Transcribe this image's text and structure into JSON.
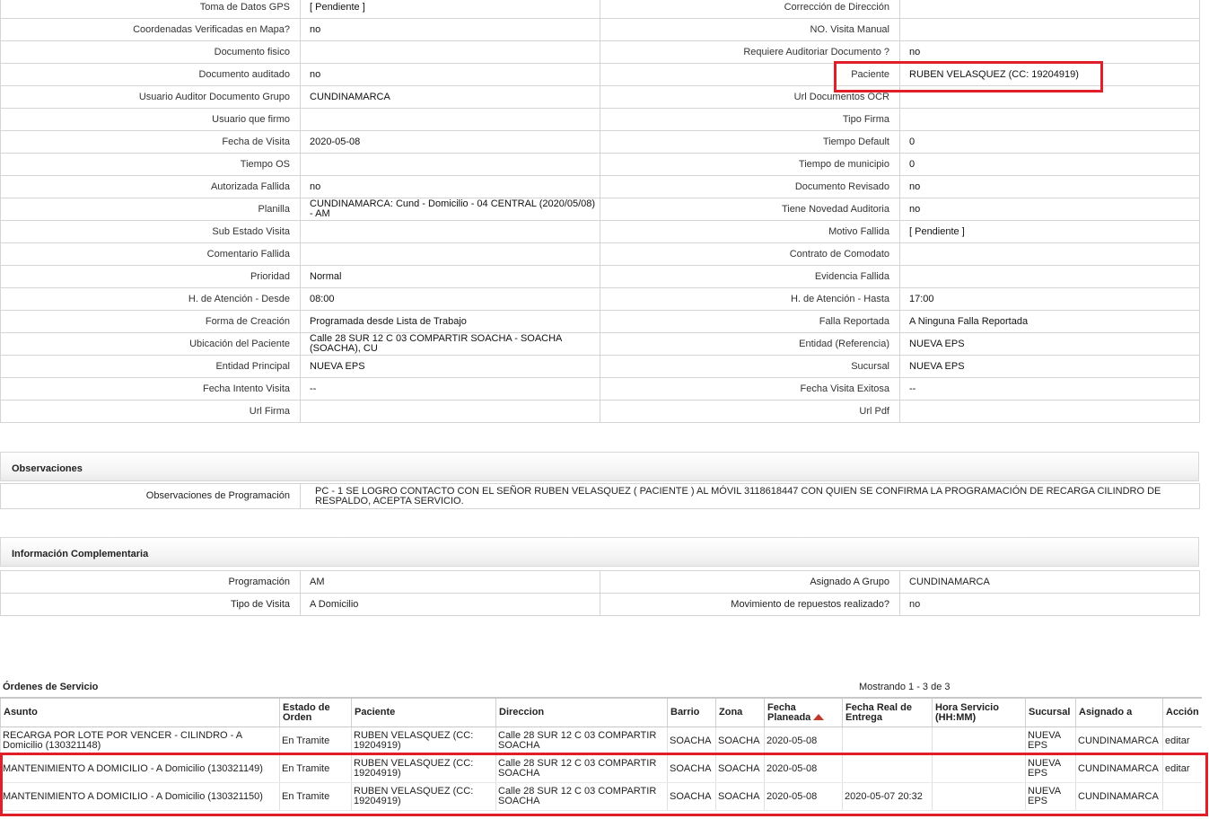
{
  "detail_rows": [
    {
      "l1": "Toma de Datos GPS",
      "v1": "[ Pendiente ]",
      "l2": "Corrección de Dirección",
      "v2": ""
    },
    {
      "l1": "Coordenadas Verificadas en Mapa?",
      "v1": "no",
      "l2": "NO. Visita Manual",
      "v2": ""
    },
    {
      "l1": "Documento fisico",
      "v1": "",
      "l2": "Requiere Auditoriar Documento ?",
      "v2": "no"
    },
    {
      "l1": "Documento auditado",
      "v1": "no",
      "l2": "Paciente",
      "v2": "RUBEN VELASQUEZ (CC: 19204919)"
    },
    {
      "l1": "Usuario Auditor Documento Grupo",
      "v1": "CUNDINAMARCA",
      "l2": "Url Documentos OCR",
      "v2": ""
    },
    {
      "l1": "Usuario que firmo",
      "v1": "",
      "l2": "Tipo Firma",
      "v2": ""
    },
    {
      "l1": "Fecha de Visita",
      "v1": "2020-05-08",
      "l2": "Tiempo Default",
      "v2": "0"
    },
    {
      "l1": "Tiempo OS",
      "v1": "",
      "l2": "Tiempo de municipio",
      "v2": "0"
    },
    {
      "l1": "Autorizada Fallida",
      "v1": "no",
      "l2": "Documento Revisado",
      "v2": "no"
    },
    {
      "l1": "Planilla",
      "v1": "CUNDINAMARCA: Cund - Domicilio - 04 CENTRAL (2020/05/08) - AM",
      "l2": "Tiene Novedad Auditoria",
      "v2": "no"
    },
    {
      "l1": "Sub Estado Visita",
      "v1": "",
      "l2": "Motivo Fallida",
      "v2": "[ Pendiente ]"
    },
    {
      "l1": "Comentario Fallida",
      "v1": "",
      "l2": "Contrato de Comodato",
      "v2": ""
    },
    {
      "l1": "Prioridad",
      "v1": "Normal",
      "l2": "Evidencia Fallida",
      "v2": ""
    },
    {
      "l1": "H. de Atención - Desde",
      "v1": "08:00",
      "l2": "H. de Atención - Hasta",
      "v2": "17:00"
    },
    {
      "l1": "Forma de Creación",
      "v1": "Programada desde Lista de Trabajo",
      "l2": "Falla Reportada",
      "v2": "A Ninguna Falla Reportada"
    },
    {
      "l1": "Ubicación del Paciente",
      "v1": "Calle 28 SUR 12 C 03 COMPARTIR SOACHA - SOACHA (SOACHA), CU",
      "l2": "Entidad (Referencia)",
      "v2": "NUEVA EPS"
    },
    {
      "l1": "Entidad Principal",
      "v1": "NUEVA EPS",
      "l2": "Sucursal",
      "v2": "NUEVA EPS"
    },
    {
      "l1": "Fecha Intento Visita",
      "v1": "--",
      "l2": "Fecha Visita Exitosa",
      "v2": "--"
    },
    {
      "l1": "Url Firma",
      "v1": "",
      "l2": "Url Pdf",
      "v2": ""
    }
  ],
  "observaciones": {
    "title": "Observaciones",
    "label": "Observaciones de Programación",
    "value": "PC - 1 SE LOGRO CONTACTO CON EL SEÑOR RUBEN VELASQUEZ ( PACIENTE ) AL MÓVIL 3118618447 CON QUIEN SE CONFIRMA LA PROGRAMACIÓN DE RECARGA CILINDRO DE RESPALDO, ACEPTA SERVICIO."
  },
  "complementaria": {
    "title": "Información Complementaria",
    "rows": [
      {
        "l1": "Programación",
        "v1": "AM",
        "l2": "Asignado A Grupo",
        "v2": "CUNDINAMARCA"
      },
      {
        "l1": "Tipo de Visita",
        "v1": "A Domicilio",
        "l2": "Movimiento de repuestos realizado?",
        "v2": "no"
      }
    ]
  },
  "ordenes": {
    "title": "Órdenes de Servicio",
    "count": "Mostrando 1 - 3 de 3",
    "headers": [
      "Asunto",
      "Estado de Orden",
      "Paciente",
      "Direccion",
      "Barrio",
      "Zona",
      "Fecha Planeada",
      "Fecha Real de Entrega",
      "Hora Servicio (HH:MM)",
      "Sucursal",
      "Asignado a",
      "Acción"
    ],
    "rows": [
      {
        "asunto": "RECARGA POR LOTE POR VENCER - CILINDRO - A Domicilio (130321148)",
        "estado": "En Tramite",
        "paciente": "RUBEN VELASQUEZ (CC: 19204919)",
        "direccion": "Calle 28 SUR 12 C 03 COMPARTIR SOACHA",
        "barrio": "SOACHA",
        "zona": "SOACHA",
        "fecha_planeada": "2020-05-08",
        "fecha_real": "",
        "hora": "",
        "sucursal": "NUEVA EPS",
        "asignado": "CUNDINAMARCA",
        "accion": "editar"
      },
      {
        "asunto": "MANTENIMIENTO A DOMICILIO - A Domicilio (130321149)",
        "estado": "En Tramite",
        "paciente": "RUBEN VELASQUEZ (CC: 19204919)",
        "direccion": "Calle 28 SUR 12 C 03 COMPARTIR SOACHA",
        "barrio": "SOACHA",
        "zona": "SOACHA",
        "fecha_planeada": "2020-05-08",
        "fecha_real": "",
        "hora": "",
        "sucursal": "NUEVA EPS",
        "asignado": "CUNDINAMARCA",
        "accion": "editar"
      },
      {
        "asunto": "MANTENIMIENTO A DOMICILIO - A Domicilio (130321150)",
        "estado": "En Tramite",
        "paciente": "RUBEN VELASQUEZ (CC: 19204919)",
        "direccion": "Calle 28 SUR 12 C 03 COMPARTIR SOACHA",
        "barrio": "SOACHA",
        "zona": "SOACHA",
        "fecha_planeada": "2020-05-08",
        "fecha_real": "2020-05-07 20:32",
        "hora": "",
        "sucursal": "NUEVA EPS",
        "asignado": "CUNDINAMARCA",
        "accion": ""
      }
    ]
  },
  "colors": {
    "highlight": "#e01f2b",
    "sort_arrow": "#c0392b"
  },
  "icons": {
    "sort": "sort-ascending-icon"
  }
}
